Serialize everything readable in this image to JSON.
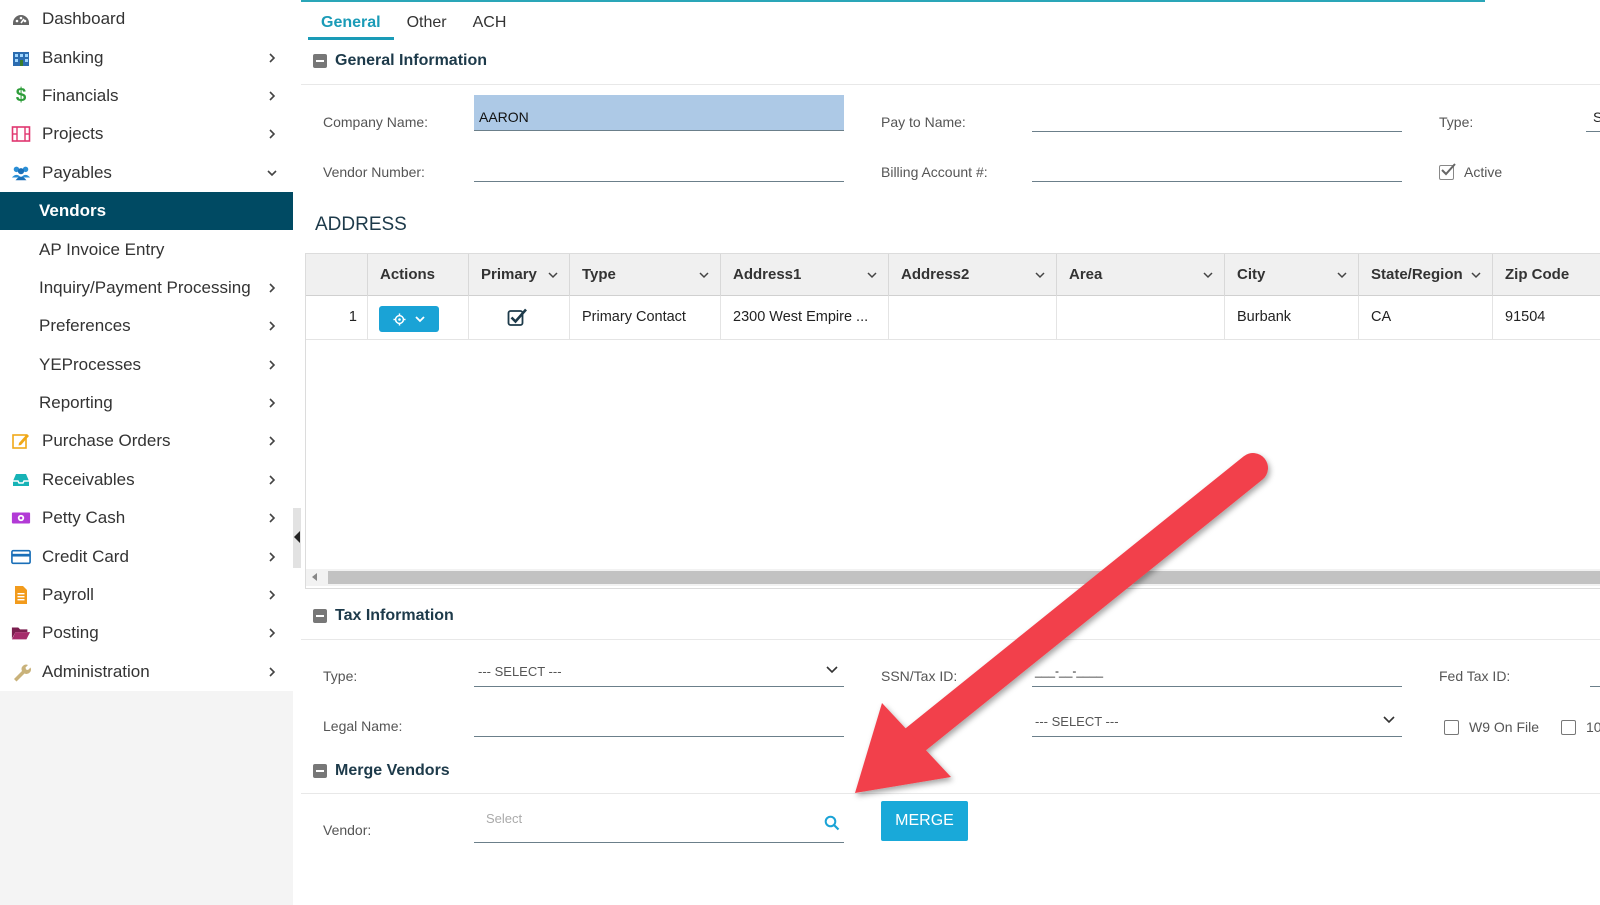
{
  "sidebar": {
    "items": [
      {
        "label": "Dashboard",
        "icon": "dashboard-icon"
      },
      {
        "label": "Banking",
        "icon": "bank-icon"
      },
      {
        "label": "Financials",
        "icon": "dollar-icon"
      },
      {
        "label": "Projects",
        "icon": "film-icon"
      },
      {
        "label": "Payables",
        "icon": "users-icon"
      },
      {
        "label": "Vendors"
      },
      {
        "label": "AP Invoice Entry"
      },
      {
        "label": "Inquiry/Payment Processing"
      },
      {
        "label": "Preferences"
      },
      {
        "label": "YEProcesses"
      },
      {
        "label": "Reporting"
      },
      {
        "label": "Purchase Orders",
        "icon": "edit-icon"
      },
      {
        "label": "Receivables",
        "icon": "inbox-icon"
      },
      {
        "label": "Petty Cash",
        "icon": "cash-icon"
      },
      {
        "label": "Credit Card",
        "icon": "credit-card-icon"
      },
      {
        "label": "Payroll",
        "icon": "document-icon"
      },
      {
        "label": "Posting",
        "icon": "folder-open-icon"
      },
      {
        "label": "Administration",
        "icon": "wrench-icon"
      }
    ]
  },
  "tabs": [
    "General",
    "Other",
    "ACH"
  ],
  "general": {
    "title": "General Information",
    "company_name_label": "Company Name:",
    "company_name_value": "AARON",
    "pay_to_name_label": "Pay to Name:",
    "type_label": "Type:",
    "type_value_partial": "S",
    "vendor_number_label": "Vendor Number:",
    "billing_account_label": "Billing Account #:",
    "active_label": "Active"
  },
  "address": {
    "title": "ADDRESS",
    "columns": [
      "Actions",
      "Primary",
      "Type",
      "Address1",
      "Address2",
      "Area",
      "City",
      "State/Region",
      "Zip Code"
    ],
    "rows": [
      {
        "index": "1",
        "type": "Primary Contact",
        "address1": "2300 West Empire ...",
        "address2": "",
        "area": "",
        "city": "Burbank",
        "state": "CA",
        "zip": "91504",
        "primary": true
      }
    ]
  },
  "tax": {
    "title": "Tax Information",
    "type_label": "Type:",
    "type_select": "--- SELECT ---",
    "ssn_label": "SSN/Tax ID:",
    "ssn_value": "___-__-____",
    "fed_tax_label": "Fed Tax ID:",
    "legal_name_label": "Legal Name:",
    "second_select": "--- SELECT ---",
    "w9_label": "W9 On File",
    "partial_label": "10"
  },
  "merge": {
    "title": "Merge Vendors",
    "vendor_label": "Vendor:",
    "vendor_placeholder": "Select",
    "merge_button": "MERGE"
  },
  "colors": {
    "accent": "#1aa3d6",
    "active_nav": "#004a63",
    "annotation_arrow": "#f2414b"
  }
}
